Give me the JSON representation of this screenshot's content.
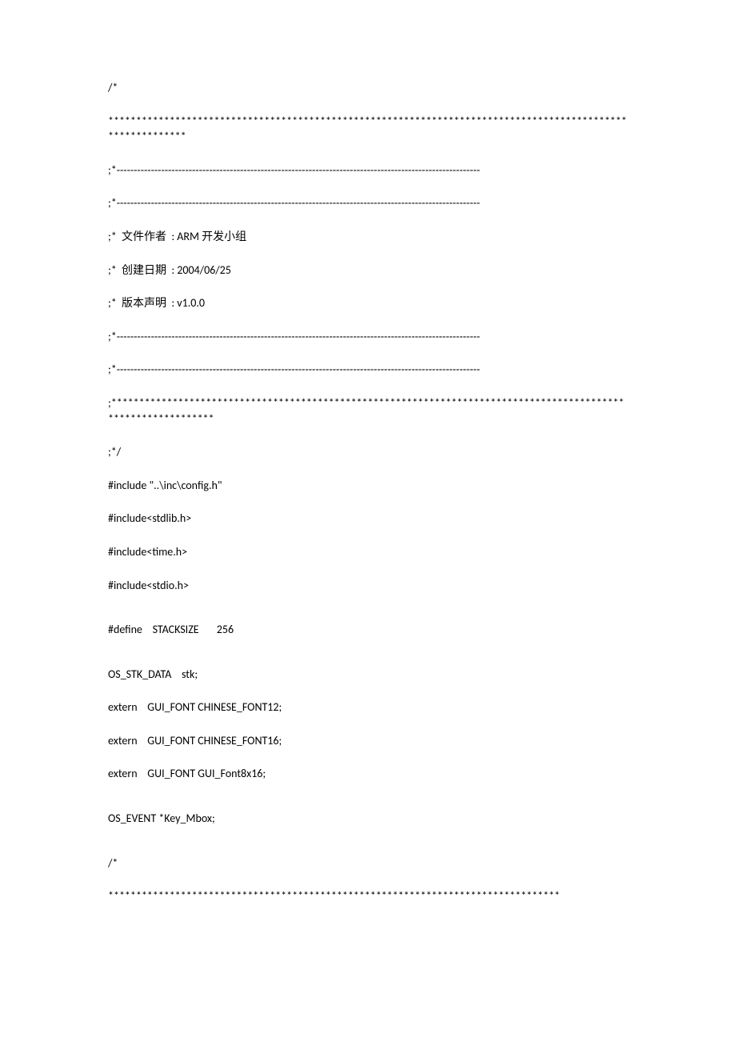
{
  "lines": {
    "l1": "/*",
    "l2": "***********************************************************************************************************",
    "l3": ";*----------------------------------------------------------------------------------------------------------",
    "l4": ";*----------------------------------------------------------------------------------------------------------",
    "l5": ";*  文件作者  : ARM 开发小组",
    "l6": ";*  创建日期  : 2004/06/25",
    "l7": ";*  版本声明  : v1.0.0",
    "l8": ";*----------------------------------------------------------------------------------------------------------",
    "l9": ";*----------------------------------------------------------------------------------------------------------",
    "l10": ";***************************************************************************************************************",
    "l11": ";*/",
    "l12": "#include \"..\\inc\\config.h\"",
    "l13": "#include<stdlib.h>",
    "l14": "#include<time.h>",
    "l15": "#include<stdio.h>",
    "l16": "#define    STACKSIZE       256",
    "l17": "OS_STK_DATA    stk;",
    "l18": "extern    GUI_FONT CHINESE_FONT12;",
    "l19": "extern    GUI_FONT CHINESE_FONT16;",
    "l20": "extern    GUI_FONT GUI_Font8x16;",
    "l21": "OS_EVENT *Key_Mbox;",
    "l22": "/*",
    "l23": "*********************************************************************************"
  }
}
